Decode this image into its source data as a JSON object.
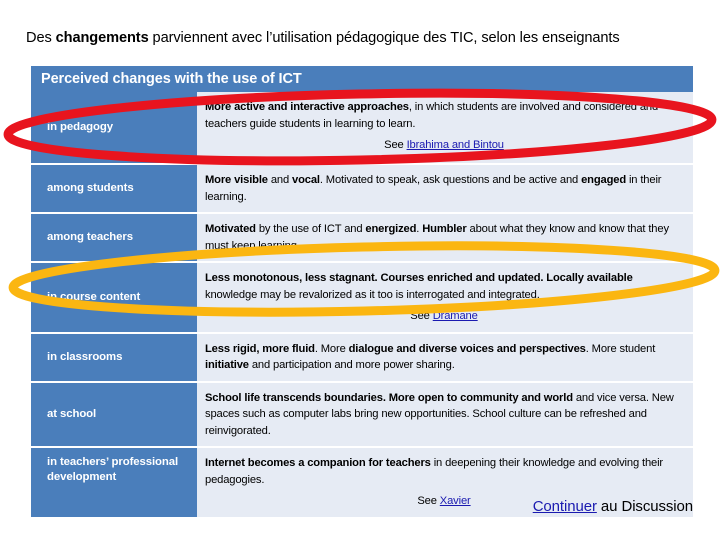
{
  "slide": {
    "heading_prefix": "Des ",
    "heading_bold": "changements",
    "heading_suffix": " parviennent avec l’utilisation pédagogique des TIC, selon les enseignants",
    "band_title": "Perceived changes with the use of ICT"
  },
  "colors": {
    "band_blue": "#4a7ebb",
    "cell_bg": "#e6ebf4",
    "link_blue": "#1a1ab0",
    "annotation_red": "#e8141e",
    "annotation_yellow": "#fbb611"
  },
  "table": {
    "rows": [
      {
        "label": "in pedagogy",
        "body_bold": "More active and interactive approaches",
        "body_rest": ", in which students are involved and considered and teachers guide students in learning to learn.",
        "see_prefix": "See ",
        "see_link": "Ibrahima and Bintou"
      },
      {
        "label": "among students",
        "body_bold": "More visible",
        "body_mid1": " and ",
        "body_bold2": "vocal",
        "body_mid2": ". Motivated to speak, ask questions and be active and ",
        "body_bold3": "engaged",
        "body_rest": " in their learning.",
        "see_prefix": "",
        "see_link": ""
      },
      {
        "label": "among teachers",
        "body_bold": "Motivated",
        "body_mid1": " by the use of ICT and ",
        "body_bold2": "energized",
        "body_mid2": ". ",
        "body_bold3": "Humbler",
        "body_rest": " about what they know and know that they must keep learning.",
        "see_prefix": "",
        "see_link": ""
      },
      {
        "label": "in course content",
        "body_bold": "Less monotonous, less stagnant. Courses enriched and updated. Locally available",
        "body_rest": " knowledge may be revalorized as it too is interrogated and integrated.",
        "see_prefix": "See ",
        "see_link": "Dramane"
      },
      {
        "label": "in classrooms",
        "body_bold": "Less rigid, more fluid",
        "body_mid1": ". More ",
        "body_bold2": "dialogue and diverse voices and perspectives",
        "body_mid2": ". More student ",
        "body_bold3": "initiative",
        "body_rest": " and participation and more power sharing.",
        "see_prefix": "",
        "see_link": ""
      },
      {
        "label": "at school",
        "body_bold": "School life transcends boundaries. More open to community and world",
        "body_rest": " and vice versa. New spaces such as computer labs bring new opportunities. School culture can be refreshed and reinvigorated.",
        "see_prefix": "",
        "see_link": ""
      },
      {
        "label": "in teachers’ professional development",
        "body_bold": "Internet becomes a companion for teachers",
        "body_rest": " in deepening their knowledge and evolving their pedagogies.",
        "see_prefix": "See ",
        "see_link": "Xavier"
      }
    ]
  },
  "annotations": [
    {
      "name": "red-ellipse-pedagogy",
      "color": "#e8141e",
      "target_row": "in pedagogy"
    },
    {
      "name": "yellow-ellipse-course-content",
      "color": "#fbb611",
      "target_row": "in course content"
    }
  ],
  "footer": {
    "link_text": "Continuer",
    "rest_text": " au Discussion"
  }
}
